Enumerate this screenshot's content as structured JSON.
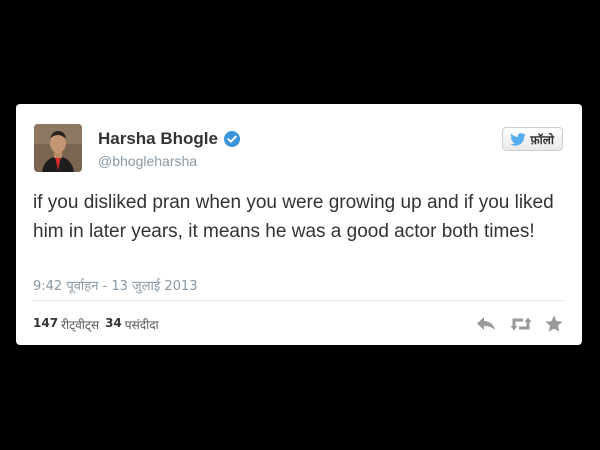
{
  "tweet": {
    "author_name": "Harsha Bhogle",
    "author_handle": "@bhogleharsha",
    "follow_label": "फ़ॉलो",
    "text": "if you disliked pran when you were growing up and if you liked him in later years, it means he was a good actor both times!",
    "timestamp": "9:42 पूर्वाहन - 13 जुलाई 2013",
    "retweets_count": "147",
    "retweets_label": "रीट्वीट्स",
    "favorites_count": "34",
    "favorites_label": "पसंदीदा"
  },
  "icons": {
    "verified": "verified-badge-icon",
    "twitter_bird": "twitter-bird-icon",
    "reply": "reply-icon",
    "retweet": "retweet-icon",
    "favorite": "star-icon"
  },
  "colors": {
    "background": "#000000",
    "card": "#ffffff",
    "verified": "#3b94d9",
    "bird": "#55acee",
    "meta_text": "#8899a6",
    "action_icon": "#999999"
  }
}
